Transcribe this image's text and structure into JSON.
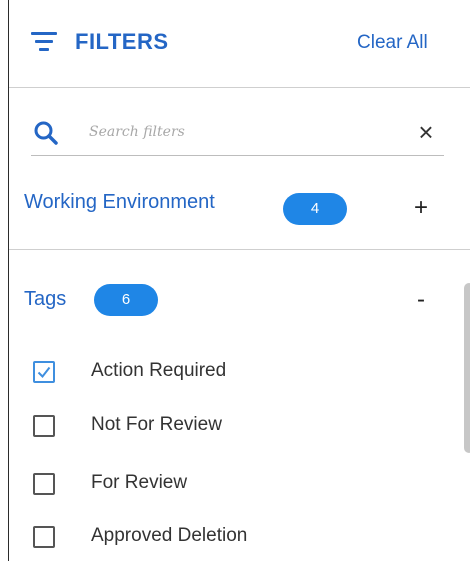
{
  "header": {
    "title": "FILTERS",
    "clear_all_label": "Clear All",
    "icon": "filter-lines-icon"
  },
  "search": {
    "placeholder": "Search filters",
    "value": "",
    "search_icon": "search-icon",
    "clear_icon": "close-icon",
    "clear_glyph": "×"
  },
  "sections": {
    "working_environment": {
      "title": "Working Environment",
      "count": "4",
      "toggle": "+"
    },
    "tags": {
      "title": "Tags",
      "count": "6",
      "toggle": "-",
      "items": [
        {
          "label": "Action Required",
          "checked": true
        },
        {
          "label": "Not For Review",
          "checked": false
        },
        {
          "label": "For Review",
          "checked": false
        },
        {
          "label": "Approved Deletion",
          "checked": false
        }
      ]
    }
  },
  "colors": {
    "accent": "#2466c5",
    "badge": "#1f86e6",
    "checkbox_checked": "#3f8fdf"
  }
}
